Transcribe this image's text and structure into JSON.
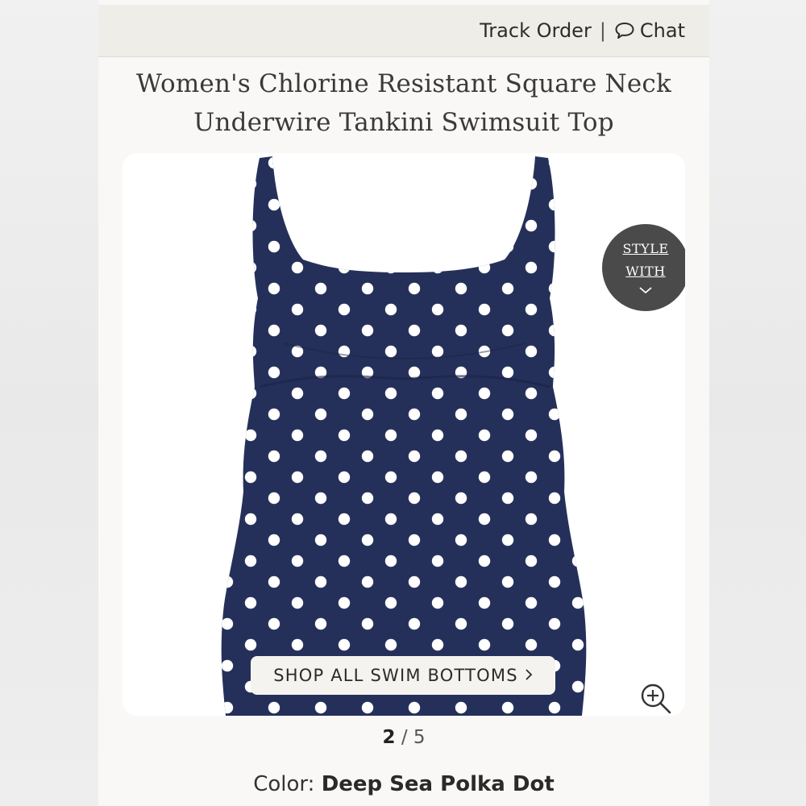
{
  "header": {
    "track_order": "Track Order",
    "separator": "|",
    "chat": "Chat"
  },
  "product": {
    "title_line1": "Women's Chlorine Resistant Square Neck",
    "title_line2": "Underwire Tankini Swimsuit Top",
    "style_with_line1": "STYLE",
    "style_with_line2": "WITH",
    "shop_all_label": "SHOP ALL SWIM BOTTOMS",
    "pager_current": "2",
    "pager_sep": "/",
    "pager_total": "5",
    "color_label": "Color:",
    "color_value": "Deep Sea Polka Dot"
  },
  "colors": {
    "navy": "#25305a",
    "dot": "#ffffff",
    "badge": "#4a4a4a"
  }
}
